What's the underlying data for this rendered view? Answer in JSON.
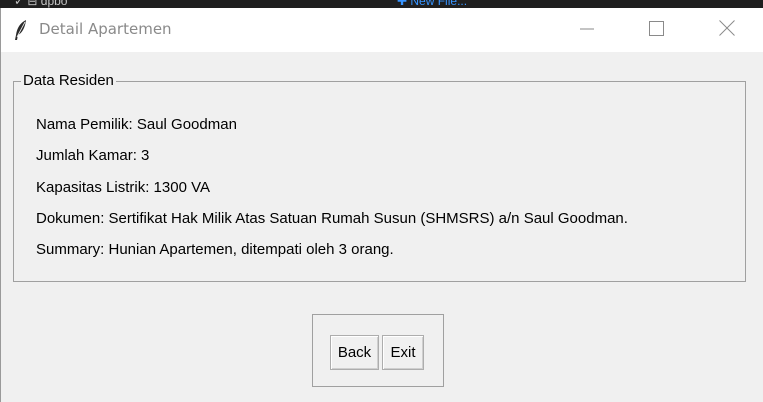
{
  "background": {
    "left_text": "✓ ⊟ dpbo",
    "mid_text": "✚ New File..."
  },
  "window": {
    "title": "Detail Apartemen",
    "icon": "feather-icon"
  },
  "controls": {
    "minimize_icon": "minimize-icon",
    "maximize_icon": "maximize-icon",
    "close_icon": "close-icon"
  },
  "resident": {
    "group_label": "Data Residen",
    "lines": [
      "Nama Pemilik: Saul Goodman",
      "Jumlah Kamar: 3",
      "Kapasitas Listrik: 1300 VA",
      "Dokumen: Sertifikat Hak Milik Atas Satuan Rumah Susun (SHMSRS) a/n Saul Goodman.",
      "Summary: Hunian Apartemen, ditempati oleh 3 orang."
    ]
  },
  "buttons": {
    "back": "Back",
    "exit": "Exit"
  },
  "colors": {
    "window_bg": "#f0f0f0",
    "titlebar_bg": "#ffffff",
    "title_text": "#8a8a8a",
    "border": "#a0a0a0"
  }
}
